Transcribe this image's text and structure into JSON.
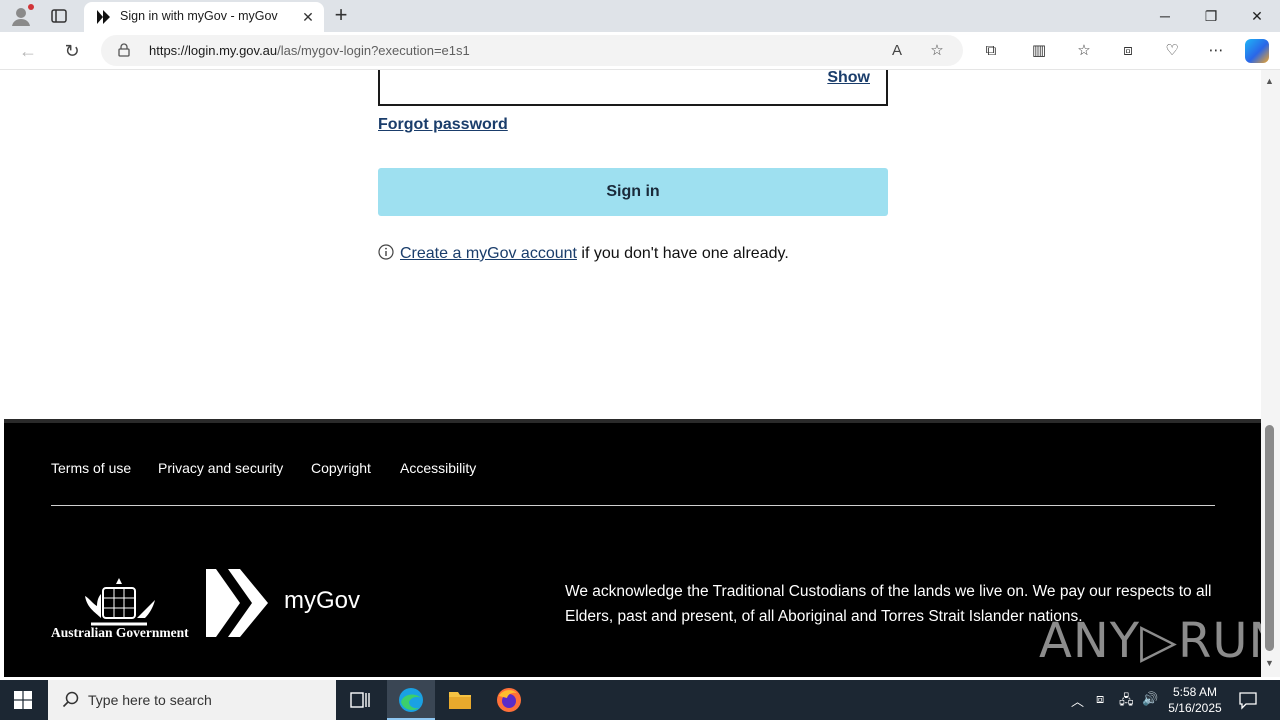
{
  "browser": {
    "tab_title": "Sign in with myGov - myGov",
    "url_host": "https://login.my.gov.au",
    "url_path": "/las/mygov-login?execution=e1s1"
  },
  "login": {
    "show_label": "Show",
    "forgot_label": "Forgot password",
    "signin_label": "Sign in",
    "create_link": "Create a myGov account",
    "create_suffix": " if you don't have one already."
  },
  "footer": {
    "links": [
      "Terms of use",
      "Privacy and security",
      "Copyright",
      "Accessibility"
    ],
    "gov_name": "Australian Government",
    "brand": "myGov",
    "acknowledgement": "We acknowledge the Traditional Custodians of the lands we live on. We pay our respects to all Elders, past and present, of all Aboriginal and Torres Strait Islander nations.",
    "watermark": "ANY▷RUN"
  },
  "taskbar": {
    "search_placeholder": "Type here to search",
    "time": "5:58 AM",
    "date": "5/16/2025"
  },
  "colors": {
    "signin_bg": "#9ee0f0",
    "link": "#1a3d6b",
    "footer_bg": "#000000"
  }
}
